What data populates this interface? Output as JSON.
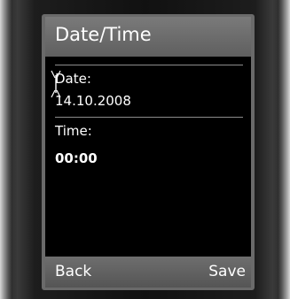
{
  "screen": {
    "title": "Date/Time"
  },
  "fields": {
    "date": {
      "label": "Date:",
      "value": "14.10.2008"
    },
    "time": {
      "label": "Time:",
      "value": "00:00"
    }
  },
  "softkeys": {
    "left": "Back",
    "right": "Save"
  },
  "icons": {
    "cursor": "text-cursor-icon"
  },
  "colors": {
    "screen_background": "#000000",
    "title_bar": "#6b6b6b",
    "text": "#ffffff",
    "divider": "#8c8c8c"
  }
}
